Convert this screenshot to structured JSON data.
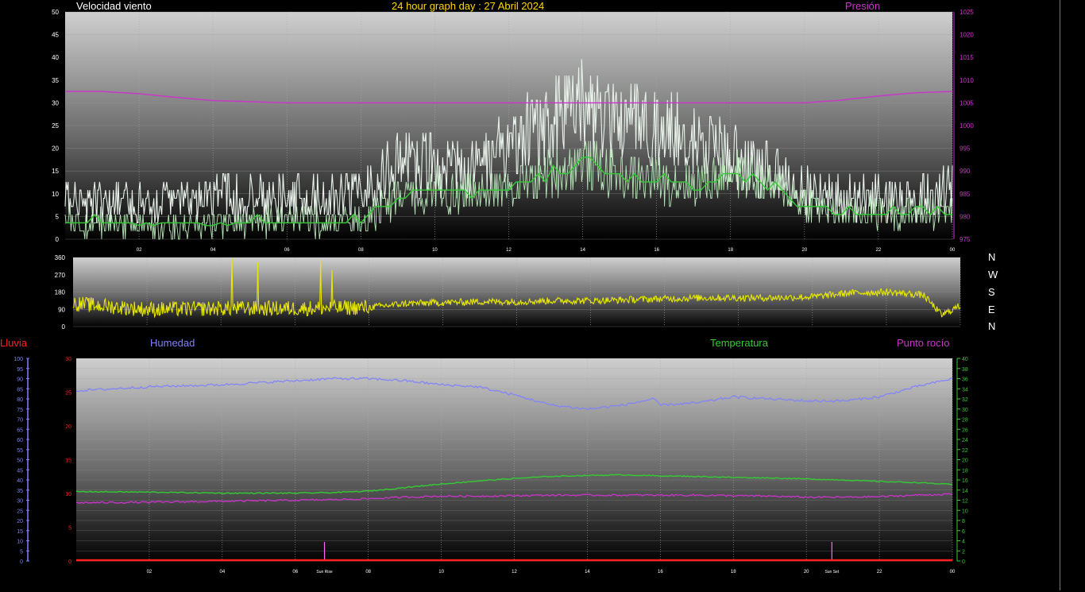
{
  "title": "24 hour graph day : 27 Abril 2024",
  "compass": [
    "N",
    "W",
    "S",
    "E",
    "N"
  ],
  "labels": {
    "wind": "Velocidad viento",
    "pressure": "Presión",
    "rain": "Lluvia",
    "humidity": "Humedad",
    "temperature": "Temperatura",
    "dewpoint": "Punto rocío",
    "sunrise": "Sun Rise",
    "sunset": "Sun Set"
  },
  "colors": {
    "title": "#ffd700",
    "wind_gust": "#ffffff",
    "wind_avg": "#33cc33",
    "pressure": "#cc33cc",
    "direction": "#e8e800",
    "humidity": "#8080ff",
    "temperature": "#33cc33",
    "dewpoint": "#cc33cc",
    "rain": "#ff2020"
  },
  "chart_data": [
    {
      "type": "line",
      "title": "Velocidad viento / Presión",
      "x_ticks": [
        "02",
        "04",
        "06",
        "08",
        "10",
        "12",
        "14",
        "16",
        "18",
        "20",
        "22",
        "00"
      ],
      "ylim": [
        0,
        50
      ],
      "y_ticks": [
        "0",
        "5",
        "10",
        "15",
        "20",
        "25",
        "30",
        "35",
        "40",
        "45",
        "50"
      ],
      "y2lim": [
        975,
        1025
      ],
      "y2_ticks": [
        "975",
        "980",
        "985",
        "990",
        "995",
        "1000",
        "1005",
        "1010",
        "1015",
        "1020",
        "1025"
      ],
      "series": [
        {
          "name": "Velocidad viento",
          "hours": [
            0,
            2,
            4,
            6,
            8,
            9,
            10,
            11,
            12,
            13,
            14,
            15,
            16,
            17,
            18,
            19,
            20,
            21,
            22,
            23,
            24
          ],
          "values": [
            8,
            8,
            9,
            9,
            10,
            16,
            16,
            15,
            20,
            26,
            29,
            26,
            24,
            22,
            18,
            15,
            11,
            9,
            9,
            9,
            11
          ]
        },
        {
          "name": "",
          "hours": [
            0,
            2,
            4,
            6,
            8,
            9,
            10,
            11,
            12,
            13,
            14,
            15,
            16,
            17,
            18,
            19,
            20,
            21,
            22,
            23,
            24
          ],
          "values": [
            4,
            3,
            3,
            4,
            4,
            9,
            11,
            10,
            11,
            14,
            17,
            14,
            13,
            12,
            15,
            12,
            8,
            6,
            6,
            6,
            6
          ]
        },
        {
          "name": "Presión",
          "hours": [
            0,
            1,
            2,
            3,
            4,
            6,
            8,
            10,
            12,
            14,
            16,
            18,
            20,
            21,
            22,
            23,
            24
          ],
          "values": [
            1007.5,
            1007.5,
            1007,
            1006.2,
            1005.5,
            1005,
            1005,
            1005,
            1005,
            1005,
            1005,
            1005,
            1005,
            1005.6,
            1006.5,
            1007.2,
            1007.5
          ]
        }
      ]
    },
    {
      "type": "line",
      "title": "",
      "x_ticks": [
        "02",
        "04",
        "06",
        "08",
        "10",
        "12",
        "14",
        "16",
        "18",
        "20",
        "22",
        "00"
      ],
      "ylim": [
        0,
        360
      ],
      "y_ticks": [
        "0",
        "90",
        "180",
        "270",
        "360"
      ],
      "series": [
        {
          "name": "",
          "hours": [
            0,
            2,
            4,
            6,
            8,
            9,
            10,
            11,
            12,
            13,
            14,
            15,
            16,
            17,
            18,
            19,
            20,
            21,
            22,
            23,
            23.5,
            24
          ],
          "values": [
            120,
            90,
            95,
            95,
            100,
            120,
            125,
            130,
            130,
            135,
            135,
            140,
            145,
            150,
            150,
            150,
            155,
            175,
            180,
            165,
            60,
            110
          ]
        }
      ],
      "spikes": [
        {
          "hour": 4.3,
          "value": 355
        },
        {
          "hour": 5.0,
          "value": 335
        },
        {
          "hour": 6.7,
          "value": 350
        },
        {
          "hour": 7.0,
          "value": 295
        }
      ]
    },
    {
      "type": "line",
      "title": "",
      "x_ticks": [
        "02",
        "04",
        "06",
        "Sun Rise",
        "08",
        "10",
        "12",
        "14",
        "16",
        "18",
        "20",
        "Sun Set",
        "22",
        "00"
      ],
      "rain_ylim": [
        0,
        30
      ],
      "rain_ticks": [
        "0",
        "5",
        "10",
        "15",
        "20",
        "25",
        "30"
      ],
      "humidity_ylim": [
        0,
        100
      ],
      "humidity_ticks": [
        "0",
        "5",
        "10",
        "15",
        "20",
        "25",
        "30",
        "35",
        "40",
        "45",
        "50",
        "55",
        "60",
        "65",
        "70",
        "75",
        "80",
        "85",
        "90",
        "95",
        "100"
      ],
      "temp_ylim": [
        0,
        40
      ],
      "temp_ticks": [
        "0",
        "2",
        "4",
        "6",
        "8",
        "10",
        "12",
        "14",
        "16",
        "18",
        "20",
        "22",
        "24",
        "26",
        "28",
        "30",
        "32",
        "34",
        "36",
        "38",
        "40"
      ],
      "sunrise_hour": 6.8,
      "sunset_hour": 20.7,
      "series": [
        {
          "name": "Humedad",
          "hours": [
            0,
            2,
            4,
            6,
            7,
            8,
            9,
            10,
            11,
            12,
            13,
            14,
            15,
            15.8,
            16,
            17,
            18,
            19,
            20,
            21,
            22,
            23,
            24
          ],
          "values": [
            84,
            86,
            87,
            89,
            90,
            90,
            89,
            87,
            86,
            82,
            77,
            75,
            77,
            80,
            77,
            78,
            81,
            80,
            79,
            79,
            81,
            86,
            90
          ]
        },
        {
          "name": "Temperatura",
          "hours": [
            0,
            2,
            4,
            6,
            7,
            8,
            9,
            10,
            11,
            12,
            13,
            14,
            15,
            16,
            17,
            18,
            19,
            20,
            21,
            22,
            23,
            24
          ],
          "values": [
            13.7,
            13.6,
            13.4,
            13.4,
            13.5,
            13.8,
            14.5,
            15.2,
            15.8,
            16.3,
            16.7,
            16.9,
            17.0,
            16.8,
            16.7,
            16.5,
            16.4,
            16.2,
            16.0,
            15.7,
            15.5,
            15.1
          ]
        },
        {
          "name": "Punto rocío",
          "hours": [
            0,
            2,
            4,
            6,
            7,
            8,
            9,
            10,
            11,
            12,
            13,
            14,
            15,
            16,
            17,
            18,
            19,
            20,
            21,
            22,
            23,
            24
          ],
          "values": [
            11.5,
            11.6,
            11.8,
            12.0,
            12.1,
            12.3,
            12.6,
            12.8,
            12.8,
            12.9,
            13.0,
            13.0,
            13.0,
            13.0,
            13.0,
            12.9,
            12.8,
            12.6,
            12.6,
            12.7,
            13.0,
            13.2
          ]
        },
        {
          "name": "Lluvia",
          "hours": [
            0,
            24
          ],
          "values": [
            0,
            0
          ]
        }
      ]
    }
  ]
}
